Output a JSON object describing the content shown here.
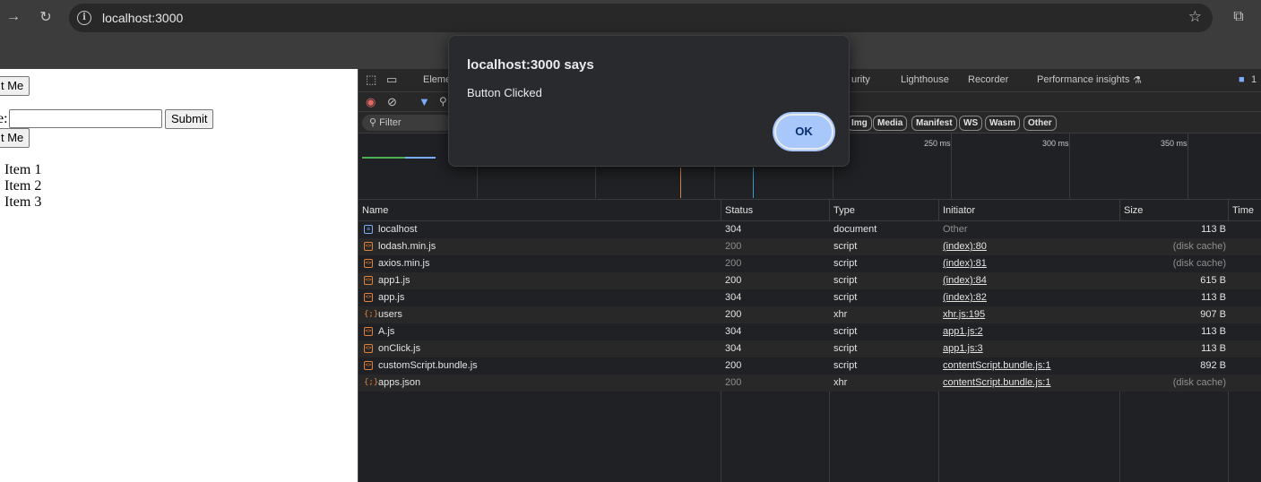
{
  "browser": {
    "url": "localhost:3000"
  },
  "page": {
    "button_top": "t Me",
    "label": "e:",
    "submit": "Submit",
    "button_bottom": "t Me",
    "list_items": [
      "Item 1",
      "Item 2",
      "Item 3"
    ]
  },
  "devtools": {
    "tabs": {
      "elements": "Eleme",
      "security": "urity",
      "lighthouse": "Lighthouse",
      "recorder": "Recorder",
      "performance": "Performance insights",
      "issues_count": "1"
    },
    "filter_placeholder": "Filter",
    "chips": [
      "Img",
      "Media",
      "Manifest",
      "WS",
      "Wasm",
      "Other"
    ],
    "timeline_ticks": [
      "250 ms",
      "300 ms",
      "350 ms"
    ],
    "columns": {
      "name": "Name",
      "status": "Status",
      "type": "Type",
      "initiator": "Initiator",
      "size": "Size",
      "time": "Time"
    },
    "requests": [
      {
        "name": "localhost",
        "status": "304",
        "type": "document",
        "initiator": "Other",
        "size": "113 B",
        "kind": "doc"
      },
      {
        "name": "lodash.min.js",
        "status": "200",
        "type": "script",
        "initiator": "(index):80",
        "size": "(disk cache)",
        "kind": "js"
      },
      {
        "name": "axios.min.js",
        "status": "200",
        "type": "script",
        "initiator": "(index):81",
        "size": "(disk cache)",
        "kind": "js"
      },
      {
        "name": "app1.js",
        "status": "200",
        "type": "script",
        "initiator": "(index):84",
        "size": "615 B",
        "kind": "js"
      },
      {
        "name": "app.js",
        "status": "304",
        "type": "script",
        "initiator": "(index):82",
        "size": "113 B",
        "kind": "js"
      },
      {
        "name": "users",
        "status": "200",
        "type": "xhr",
        "initiator": "xhr.js:195",
        "size": "907 B",
        "kind": "xhr"
      },
      {
        "name": "A.js",
        "status": "304",
        "type": "script",
        "initiator": "app1.js:2",
        "size": "113 B",
        "kind": "js"
      },
      {
        "name": "onClick.js",
        "status": "304",
        "type": "script",
        "initiator": "app1.js:3",
        "size": "113 B",
        "kind": "js"
      },
      {
        "name": "customScript.bundle.js",
        "status": "200",
        "type": "script",
        "initiator": "contentScript.bundle.js:1",
        "size": "892 B",
        "kind": "js"
      },
      {
        "name": "apps.json",
        "status": "200",
        "type": "xhr",
        "initiator": "contentScript.bundle.js:1",
        "size": "(disk cache)",
        "kind": "xhr"
      }
    ]
  },
  "dialog": {
    "title": "localhost:3000 says",
    "message": "Button Clicked",
    "ok": "OK"
  }
}
